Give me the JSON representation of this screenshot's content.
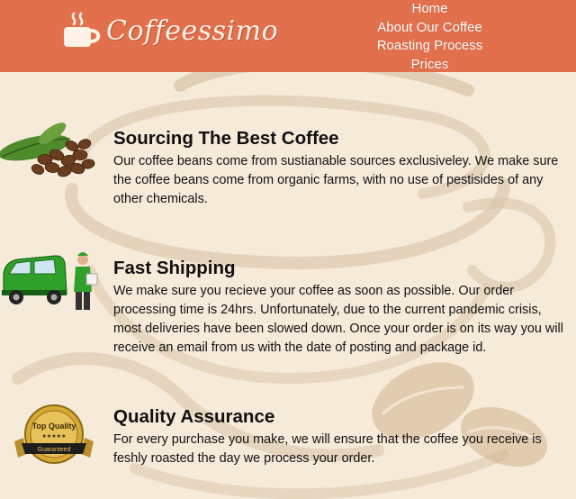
{
  "header": {
    "logo_text": "Coffeessimo",
    "logo_icon": "coffee-cup-icon",
    "nav": [
      {
        "label": "Home"
      },
      {
        "label": "About Our Coffee"
      },
      {
        "label": "Roasting Process"
      },
      {
        "label": "Prices"
      }
    ]
  },
  "sections": [
    {
      "title": "Sourcing The Best Coffee",
      "body": "Our coffee beans come from sustianable sources exclusiveley. We make sure the coffee beans come from organic farms, with no use of pestisides of any other chemicals.",
      "image": "coffee-beans-image"
    },
    {
      "title": "Fast Shipping",
      "body": "We make sure you recieve your coffee as soon as possible. Our order processing time is 24hrs. Unfortunately, due to the current pandemic crisis, most deliveries have been slowed down. Once your order is on its way you will receive an email from us with the date of posting and package id.",
      "image": "delivery-van-image"
    },
    {
      "title": "Quality Assurance",
      "body": "For every purchase you make, we will ensure that the coffee you receive is feshly roasted the day we process your order.",
      "image": "quality-badge-image",
      "badge_top": "Top Quality",
      "badge_stars": "★★★★★",
      "badge_bottom": "Guaranteed"
    }
  ],
  "colors": {
    "header_bg": "#e2704d",
    "page_bg": "#f6ead9",
    "cup_art": "#d7bfa0"
  }
}
